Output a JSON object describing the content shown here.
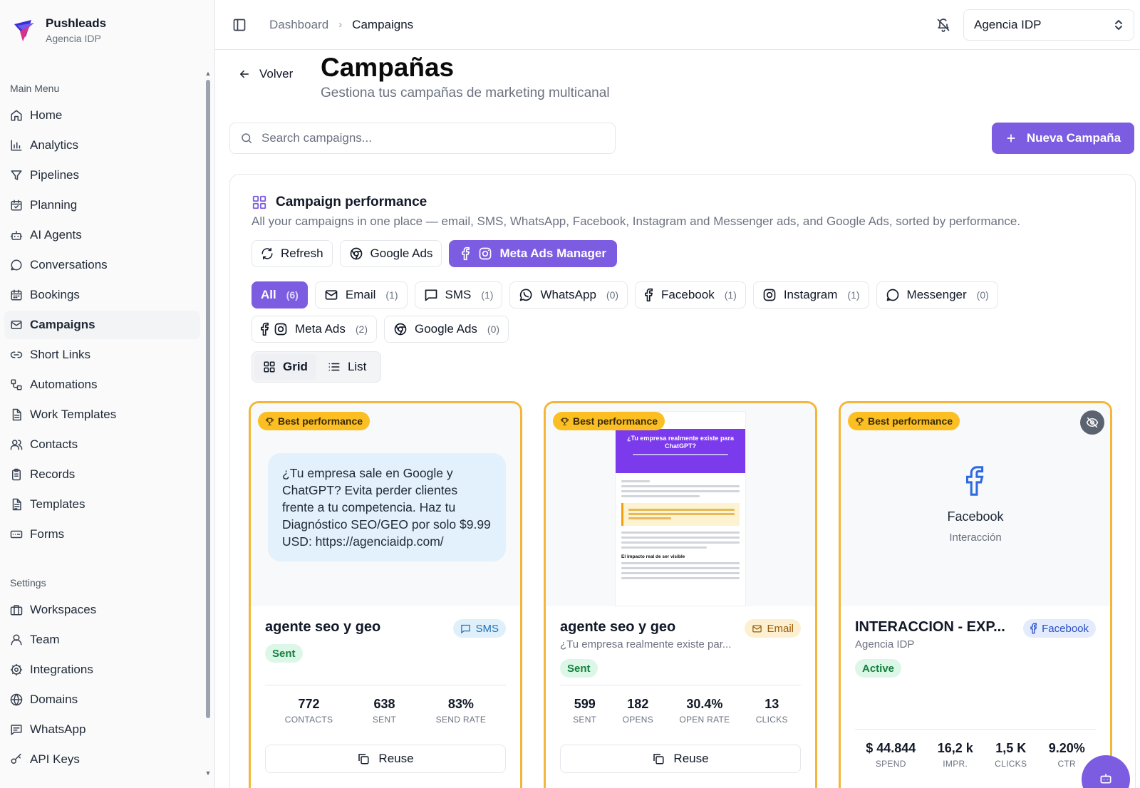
{
  "brand": {
    "name": "Pushleads",
    "sub": "Agencia IDP"
  },
  "sidebar": {
    "main_title": "Main Menu",
    "main_items": [
      {
        "label": "Home",
        "icon": "home-icon"
      },
      {
        "label": "Analytics",
        "icon": "bar-chart-icon"
      },
      {
        "label": "Pipelines",
        "icon": "filter-icon"
      },
      {
        "label": "Planning",
        "icon": "calendar-check-icon"
      },
      {
        "label": "AI Agents",
        "icon": "bot-icon"
      },
      {
        "label": "Conversations",
        "icon": "message-circle-icon"
      },
      {
        "label": "Bookings",
        "icon": "calendar-icon"
      },
      {
        "label": "Campaigns",
        "icon": "mail-icon"
      },
      {
        "label": "Short Links",
        "icon": "link-icon"
      },
      {
        "label": "Automations",
        "icon": "workflow-icon"
      },
      {
        "label": "Work Templates",
        "icon": "file-icon"
      },
      {
        "label": "Contacts",
        "icon": "users-icon"
      },
      {
        "label": "Records",
        "icon": "clipboard-icon"
      },
      {
        "label": "Templates",
        "icon": "file-text-icon"
      },
      {
        "label": "Forms",
        "icon": "form-icon"
      }
    ],
    "settings_title": "Settings",
    "settings_items": [
      {
        "label": "Workspaces",
        "icon": "briefcase-icon"
      },
      {
        "label": "Team",
        "icon": "user-icon"
      },
      {
        "label": "Integrations",
        "icon": "cog-icon"
      },
      {
        "label": "Domains",
        "icon": "globe-icon"
      },
      {
        "label": "WhatsApp",
        "icon": "message-square-icon"
      },
      {
        "label": "API Keys",
        "icon": "key-icon"
      }
    ]
  },
  "topbar": {
    "breadcrumb": [
      "Dashboard",
      "Campaigns"
    ],
    "workspace": "Agencia IDP"
  },
  "header": {
    "back": "Volver",
    "title": "Campañas",
    "subtitle": "Gestiona tus campañas de marketing multicanal"
  },
  "search": {
    "placeholder": "Search campaigns..."
  },
  "new_button": "Nueva Campaña",
  "panel": {
    "title": "Campaign performance",
    "desc": "All your campaigns in one place — email, SMS, WhatsApp, Facebook, Instagram and Messenger ads, and Google Ads, sorted by performance.",
    "actions": {
      "refresh": "Refresh",
      "google_ads": "Google Ads",
      "meta": "Meta Ads Manager"
    },
    "filters": [
      {
        "label": "All",
        "count": "(6)"
      },
      {
        "label": "Email",
        "count": "(1)"
      },
      {
        "label": "SMS",
        "count": "(1)"
      },
      {
        "label": "WhatsApp",
        "count": "(0)"
      },
      {
        "label": "Facebook",
        "count": "(1)"
      },
      {
        "label": "Instagram",
        "count": "(1)"
      },
      {
        "label": "Messenger",
        "count": "(0)"
      },
      {
        "label": "Meta Ads",
        "count": "(2)"
      },
      {
        "label": "Google Ads",
        "count": "(0)"
      }
    ],
    "view": {
      "grid": "Grid",
      "list": "List"
    }
  },
  "cards": [
    {
      "badge": "Best performance",
      "message": "¿Tu empresa sale en Google y ChatGPT? Evita perder clientes frente a tu competencia. Haz tu Diagnóstico SEO/GEO por solo $9.99 USD: https://agenciaidp.com/",
      "title": "agente seo y geo",
      "type": "SMS",
      "status": "Sent",
      "stats": [
        {
          "value": "772",
          "label": "CONTACTS"
        },
        {
          "value": "638",
          "label": "SENT"
        },
        {
          "value": "83%",
          "label": "SEND RATE"
        }
      ],
      "reuse": "Reuse"
    },
    {
      "badge": "Best performance",
      "email_heading": "¿Tu empresa realmente existe para ChatGPT?",
      "email_section": "El impacto real de ser visible",
      "title": "agente seo y geo",
      "subtitle": "¿Tu empresa realmente existe par...",
      "type": "Email",
      "status": "Sent",
      "stats": [
        {
          "value": "599",
          "label": "SENT"
        },
        {
          "value": "182",
          "label": "OPENS"
        },
        {
          "value": "30.4%",
          "label": "OPEN RATE"
        },
        {
          "value": "13",
          "label": "CLICKS"
        }
      ],
      "reuse": "Reuse"
    },
    {
      "badge": "Best performance",
      "platform": "Facebook",
      "objective": "Interacción",
      "title": "INTERACCION - EXP...",
      "subtitle": "Agencia IDP",
      "type": "Facebook",
      "status": "Active",
      "stats": [
        {
          "value": "$ 44.844",
          "label": "SPEND"
        },
        {
          "value": "16,2 k",
          "label": "IMPR."
        },
        {
          "value": "1,5 K",
          "label": "CLICKS"
        },
        {
          "value": "9.20%",
          "label": "CTR"
        }
      ]
    }
  ],
  "colors": {
    "accent": "#7c5ce0",
    "best_border": "#f4b63a",
    "best_badge": "#fbbf24"
  }
}
